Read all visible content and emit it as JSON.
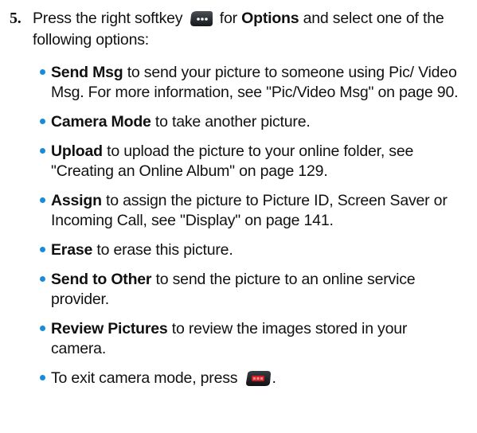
{
  "step": {
    "number": "5.",
    "text_before_icon": "Press the right softkey",
    "text_after_icon": "for",
    "options_label": "Options",
    "text_end": "and select one of the following options:"
  },
  "icons": {
    "right_softkey": "right-softkey-icon",
    "end_key": "end-key-icon"
  },
  "options": [
    {
      "label": "Send Msg",
      "desc": "to send your picture to someone using Pic/ Video Msg. For more information, see \"Pic/Video Msg\" on page 90."
    },
    {
      "label": "Camera Mode",
      "desc": "to take another picture."
    },
    {
      "label": "Upload",
      "desc": "to upload the picture to your online folder, see \"Creating an Online Album\" on page 129."
    },
    {
      "label": "Assign",
      "desc": "to assign the picture to Picture ID, Screen Saver or Incoming Call, see \"Display\" on page 141."
    },
    {
      "label": "Erase",
      "desc": "to erase this picture."
    },
    {
      "label": "Send to Other",
      "desc": "to send the picture to an online service provider."
    },
    {
      "label": "Review Pictures",
      "desc": "to review the images stored in your camera."
    }
  ],
  "exit": {
    "text_before_icon": "To exit camera mode, press",
    "text_after_icon": "."
  },
  "colors": {
    "bullet": "#1a8bd8",
    "text": "#111111"
  }
}
